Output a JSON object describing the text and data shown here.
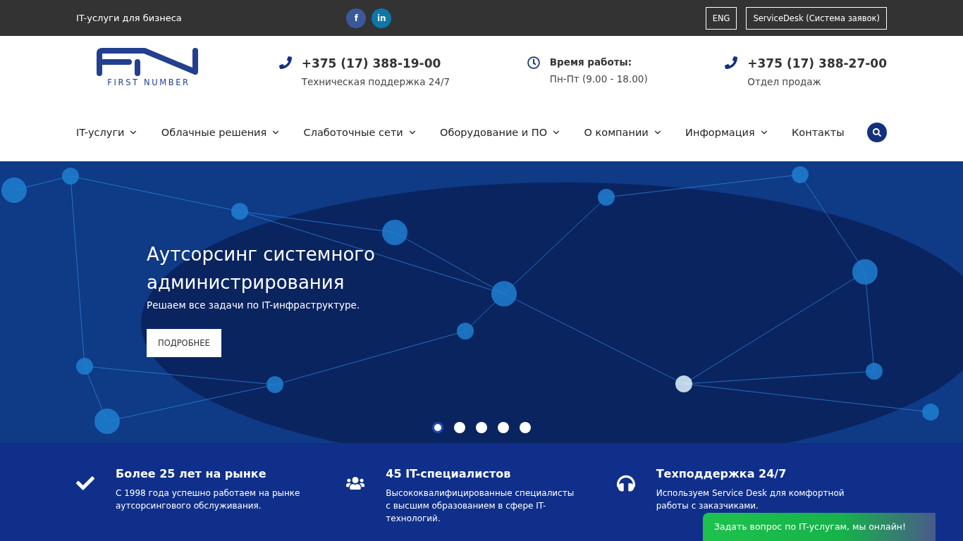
{
  "topbar": {
    "tagline": "IT-услуги для бизнеса",
    "social": [
      {
        "kind": "facebook",
        "label": "f"
      },
      {
        "kind": "linkedin",
        "label": "in"
      }
    ],
    "buttons": [
      "ENG",
      "ServiceDesk (Система заявок)"
    ]
  },
  "logo": {
    "text": "FIRST NUMBER"
  },
  "contacts": [
    {
      "kind": "phone",
      "title": "+375 (17) 388-19-00",
      "subtitle": "Техническая поддержка 24/7"
    },
    {
      "kind": "clock",
      "title": "Время работы:",
      "subtitle": "Пн-Пт (9.00 - 18.00)"
    },
    {
      "kind": "phone",
      "title": "+375 (17) 388-27-00",
      "subtitle": "Отдел продаж"
    }
  ],
  "nav": [
    {
      "label": "IT-услуги",
      "dropdown": true
    },
    {
      "label": "Облачные решения",
      "dropdown": true
    },
    {
      "label": "Слаботочные сети",
      "dropdown": true
    },
    {
      "label": "Оборудование и ПО",
      "dropdown": true
    },
    {
      "label": "О компании",
      "dropdown": true
    },
    {
      "label": "Информация",
      "dropdown": true
    },
    {
      "label": "Контакты",
      "dropdown": false
    }
  ],
  "hero": {
    "title": "Аутсорсинг системного администрирования",
    "subtitle": "Решаем все задачи по IT-инфраструктуре.",
    "button": "ПОДРОБНЕЕ",
    "dots": [
      {
        "selected": true
      },
      {
        "selected": false
      },
      {
        "selected": false
      },
      {
        "selected": false
      },
      {
        "selected": false
      }
    ]
  },
  "features": [
    {
      "kind": "check",
      "title": "Более 25 лет на рынке",
      "text": "С 1998 года успешно работаем на рынке аутсорсингового обслуживания."
    },
    {
      "kind": "team",
      "title": "45 IT-специалистов",
      "text": "Высококвалифицированные специалисты с высшим образованием в сфере IT-технологий."
    },
    {
      "kind": "headset",
      "title": "Техподдержка 24/7",
      "text": "Используем Service Desk для комфортной работы с заказчиками."
    }
  ],
  "chat": {
    "label": "Задать вопрос по IT-услугам, мы онлайн!"
  }
}
